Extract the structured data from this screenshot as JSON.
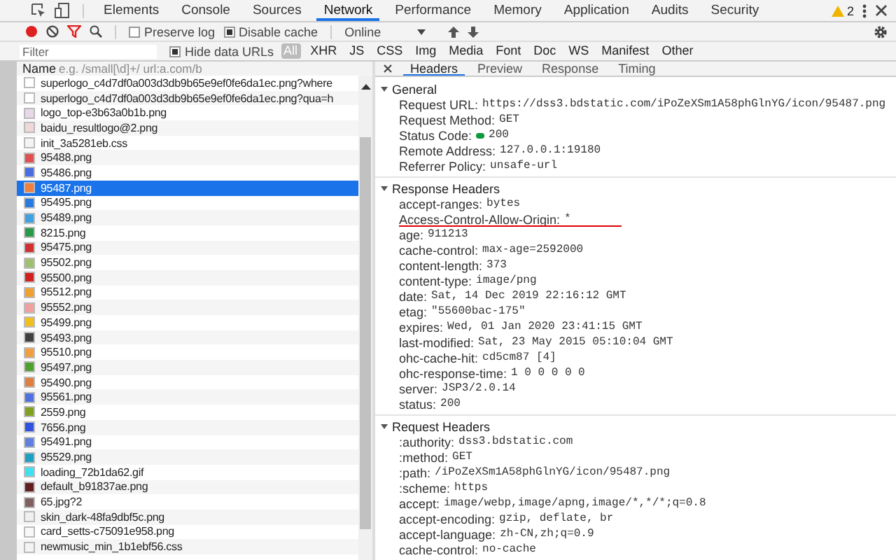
{
  "main_tabs": [
    {
      "label": "Elements",
      "selected": false
    },
    {
      "label": "Console",
      "selected": false
    },
    {
      "label": "Sources",
      "selected": false
    },
    {
      "label": "Network",
      "selected": true
    },
    {
      "label": "Performance",
      "selected": false
    },
    {
      "label": "Memory",
      "selected": false
    },
    {
      "label": "Application",
      "selected": false
    },
    {
      "label": "Audits",
      "selected": false
    },
    {
      "label": "Security",
      "selected": false
    }
  ],
  "warnings": "2",
  "toolbar": {
    "recording": true,
    "filter_active": true,
    "preserve_log": {
      "label": "Preserve log",
      "checked": false
    },
    "disable_cache": {
      "label": "Disable cache",
      "checked": true
    },
    "throttle": "Online"
  },
  "filter_bar": {
    "placeholder": "Filter",
    "hide_data_urls": {
      "label": "Hide data URLs",
      "checked": true
    },
    "types": [
      {
        "label": "All",
        "selected": true
      },
      {
        "label": "XHR",
        "selected": false
      },
      {
        "label": "JS",
        "selected": false
      },
      {
        "label": "CSS",
        "selected": false
      },
      {
        "label": "Img",
        "selected": false
      },
      {
        "label": "Media",
        "selected": false
      },
      {
        "label": "Font",
        "selected": false
      },
      {
        "label": "Doc",
        "selected": false
      },
      {
        "label": "WS",
        "selected": false
      },
      {
        "label": "Manifest",
        "selected": false
      },
      {
        "label": "Other",
        "selected": false
      }
    ]
  },
  "requests": {
    "column": "Name",
    "hint": "e.g. /small[\\d]+/ url:a.com/b",
    "rows": [
      {
        "name": "superlogo_c4d7df0a003d3db9b65e9ef0fe6da1ec.png?where",
        "color": "#ffffff",
        "selected": false
      },
      {
        "name": "superlogo_c4d7df0a003d3db9b65e9ef0fe6da1ec.png?qua=h",
        "color": "#ffffff",
        "selected": false
      },
      {
        "name": "logo_top-e3b63a0b1b.png",
        "color": "#e8d8e8",
        "selected": false
      },
      {
        "name": "baidu_resultlogo@2.png",
        "color": "#f0d8d8",
        "selected": false
      },
      {
        "name": "init_3a5281eb.css",
        "color": "#f4f4f4",
        "selected": false
      },
      {
        "name": "95488.png",
        "color": "#e05050",
        "selected": false
      },
      {
        "name": "95486.png",
        "color": "#4a6ee0",
        "selected": false
      },
      {
        "name": "95487.png",
        "color": "#f08040",
        "selected": true
      },
      {
        "name": "95495.png",
        "color": "#2a7ae0",
        "selected": false
      },
      {
        "name": "95489.png",
        "color": "#40a0e0",
        "selected": false
      },
      {
        "name": "8215.png",
        "color": "#2a9a4a",
        "selected": false
      },
      {
        "name": "95475.png",
        "color": "#d03030",
        "selected": false
      },
      {
        "name": "95502.png",
        "color": "#a0c070",
        "selected": false
      },
      {
        "name": "95500.png",
        "color": "#d02020",
        "selected": false
      },
      {
        "name": "95512.png",
        "color": "#f0a030",
        "selected": false
      },
      {
        "name": "95552.png",
        "color": "#f0a0a0",
        "selected": false
      },
      {
        "name": "95499.png",
        "color": "#f0c020",
        "selected": false
      },
      {
        "name": "95493.png",
        "color": "#404040",
        "selected": false
      },
      {
        "name": "95510.png",
        "color": "#f0a040",
        "selected": false
      },
      {
        "name": "95497.png",
        "color": "#50a030",
        "selected": false
      },
      {
        "name": "95490.png",
        "color": "#e08040",
        "selected": false
      },
      {
        "name": "95561.png",
        "color": "#5070e0",
        "selected": false
      },
      {
        "name": "2559.png",
        "color": "#80a020",
        "selected": false
      },
      {
        "name": "7656.png",
        "color": "#3050e0",
        "selected": false
      },
      {
        "name": "95491.png",
        "color": "#6080e0",
        "selected": false
      },
      {
        "name": "95529.png",
        "color": "#20a0c0",
        "selected": false
      },
      {
        "name": "loading_72b1da62.gif",
        "color": "#40e0f0",
        "selected": false
      },
      {
        "name": "default_b91837ae.png",
        "color": "#602020",
        "selected": false
      },
      {
        "name": "65.jpg?2",
        "color": "#806060",
        "selected": false
      },
      {
        "name": "skin_dark-48fa9dbf5c.png",
        "color": "#f0f0f0",
        "selected": false
      },
      {
        "name": "card_setts-c75091e958.png",
        "color": "#f8f8f8",
        "selected": false
      },
      {
        "name": "newmusic_min_1b1ebf56.css",
        "color": "#f4f4f4",
        "selected": false
      }
    ]
  },
  "detail_tabs": [
    {
      "label": "Headers",
      "selected": true
    },
    {
      "label": "Preview",
      "selected": false
    },
    {
      "label": "Response",
      "selected": false
    },
    {
      "label": "Timing",
      "selected": false
    }
  ],
  "sections": [
    {
      "title": "General",
      "expanded": true,
      "rows": [
        {
          "name": "Request URL:",
          "value": "https://dss3.bdstatic.com/iPoZeXSm1A58phGlnYG/icon/95487.png",
          "status_ok": false,
          "underlined": false
        },
        {
          "name": "Request Method:",
          "value": "GET",
          "status_ok": false,
          "underlined": false
        },
        {
          "name": "Status Code:",
          "value": "200",
          "status_ok": true,
          "underlined": false
        },
        {
          "name": "Remote Address:",
          "value": "127.0.0.1:19180",
          "status_ok": false,
          "underlined": false
        },
        {
          "name": "Referrer Policy:",
          "value": "unsafe-url",
          "status_ok": false,
          "underlined": false
        }
      ]
    },
    {
      "title": "Response Headers",
      "expanded": true,
      "rows": [
        {
          "name": "accept-ranges:",
          "value": "bytes",
          "status_ok": false,
          "underlined": false
        },
        {
          "name": "Access-Control-Allow-Origin:",
          "value": "*",
          "status_ok": false,
          "underlined": true
        },
        {
          "name": "age:",
          "value": "911213",
          "status_ok": false,
          "underlined": false
        },
        {
          "name": "cache-control:",
          "value": "max-age=2592000",
          "status_ok": false,
          "underlined": false
        },
        {
          "name": "content-length:",
          "value": "373",
          "status_ok": false,
          "underlined": false
        },
        {
          "name": "content-type:",
          "value": "image/png",
          "status_ok": false,
          "underlined": false
        },
        {
          "name": "date:",
          "value": "Sat, 14 Dec 2019 22:16:12 GMT",
          "status_ok": false,
          "underlined": false
        },
        {
          "name": "etag:",
          "value": "\"55600bac-175\"",
          "status_ok": false,
          "underlined": false
        },
        {
          "name": "expires:",
          "value": "Wed, 01 Jan 2020 23:41:15 GMT",
          "status_ok": false,
          "underlined": false
        },
        {
          "name": "last-modified:",
          "value": "Sat, 23 May 2015 05:10:04 GMT",
          "status_ok": false,
          "underlined": false
        },
        {
          "name": "ohc-cache-hit:",
          "value": "cd5cm87 [4]",
          "status_ok": false,
          "underlined": false
        },
        {
          "name": "ohc-response-time:",
          "value": "1 0 0 0 0 0",
          "status_ok": false,
          "underlined": false
        },
        {
          "name": "server:",
          "value": "JSP3/2.0.14",
          "status_ok": false,
          "underlined": false
        },
        {
          "name": "status:",
          "value": "200",
          "status_ok": false,
          "underlined": false
        }
      ]
    },
    {
      "title": "Request Headers",
      "expanded": true,
      "rows": [
        {
          "name": ":authority:",
          "value": "dss3.bdstatic.com",
          "status_ok": false,
          "underlined": false
        },
        {
          "name": ":method:",
          "value": "GET",
          "status_ok": false,
          "underlined": false
        },
        {
          "name": ":path:",
          "value": "/iPoZeXSm1A58phGlnYG/icon/95487.png",
          "status_ok": false,
          "underlined": false
        },
        {
          "name": ":scheme:",
          "value": "https",
          "status_ok": false,
          "underlined": false
        },
        {
          "name": "accept:",
          "value": "image/webp,image/apng,image/*,*/*;q=0.8",
          "status_ok": false,
          "underlined": false
        },
        {
          "name": "accept-encoding:",
          "value": "gzip, deflate, br",
          "status_ok": false,
          "underlined": false
        },
        {
          "name": "accept-language:",
          "value": "zh-CN,zh;q=0.9",
          "status_ok": false,
          "underlined": false
        },
        {
          "name": "cache-control:",
          "value": "no-cache",
          "status_ok": false,
          "underlined": false
        }
      ]
    }
  ]
}
